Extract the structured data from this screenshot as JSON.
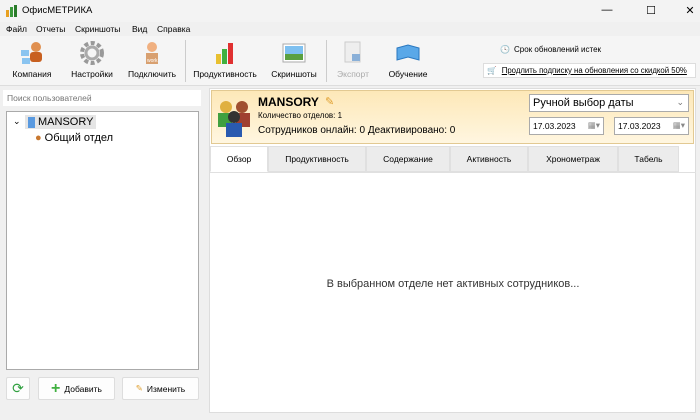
{
  "window": {
    "title": "ОфисМЕТРИКА",
    "min": "—",
    "max": "☐",
    "close": "✕"
  },
  "menu": [
    "Файл",
    "Отчеты",
    "Скриншоты",
    "Вид",
    "Справка"
  ],
  "toolbar": {
    "company": "Компания",
    "settings": "Настройки",
    "connect": "Подключить",
    "productivity": "Продуктивность",
    "screenshots": "Скриншоты",
    "export": "Экспорт",
    "training": "Обучение",
    "expired": "Срок обновлений истек",
    "renew": "Продлить подписку на обновления со скидкой 50%"
  },
  "left": {
    "search_placeholder": "Поиск пользователей",
    "tree": {
      "root": "MANSORY",
      "child": "Общий отдел"
    },
    "add": "Добавить",
    "edit": "Изменить"
  },
  "header": {
    "company": "MANSORY",
    "departments": "Количество отделов: 1",
    "online": "Сотрудников онлайн: 0 Деактивировано: 0",
    "date_mode": "Ручной выбор даты",
    "date_from": "17.03.2023",
    "date_to": "17.03.2023"
  },
  "tabs": [
    "Обзор",
    "Продуктивность",
    "Содержание",
    "Активность",
    "Хронометраж",
    "Табель"
  ],
  "content": {
    "empty": "В выбранном отделе нет активных сотрудников..."
  }
}
